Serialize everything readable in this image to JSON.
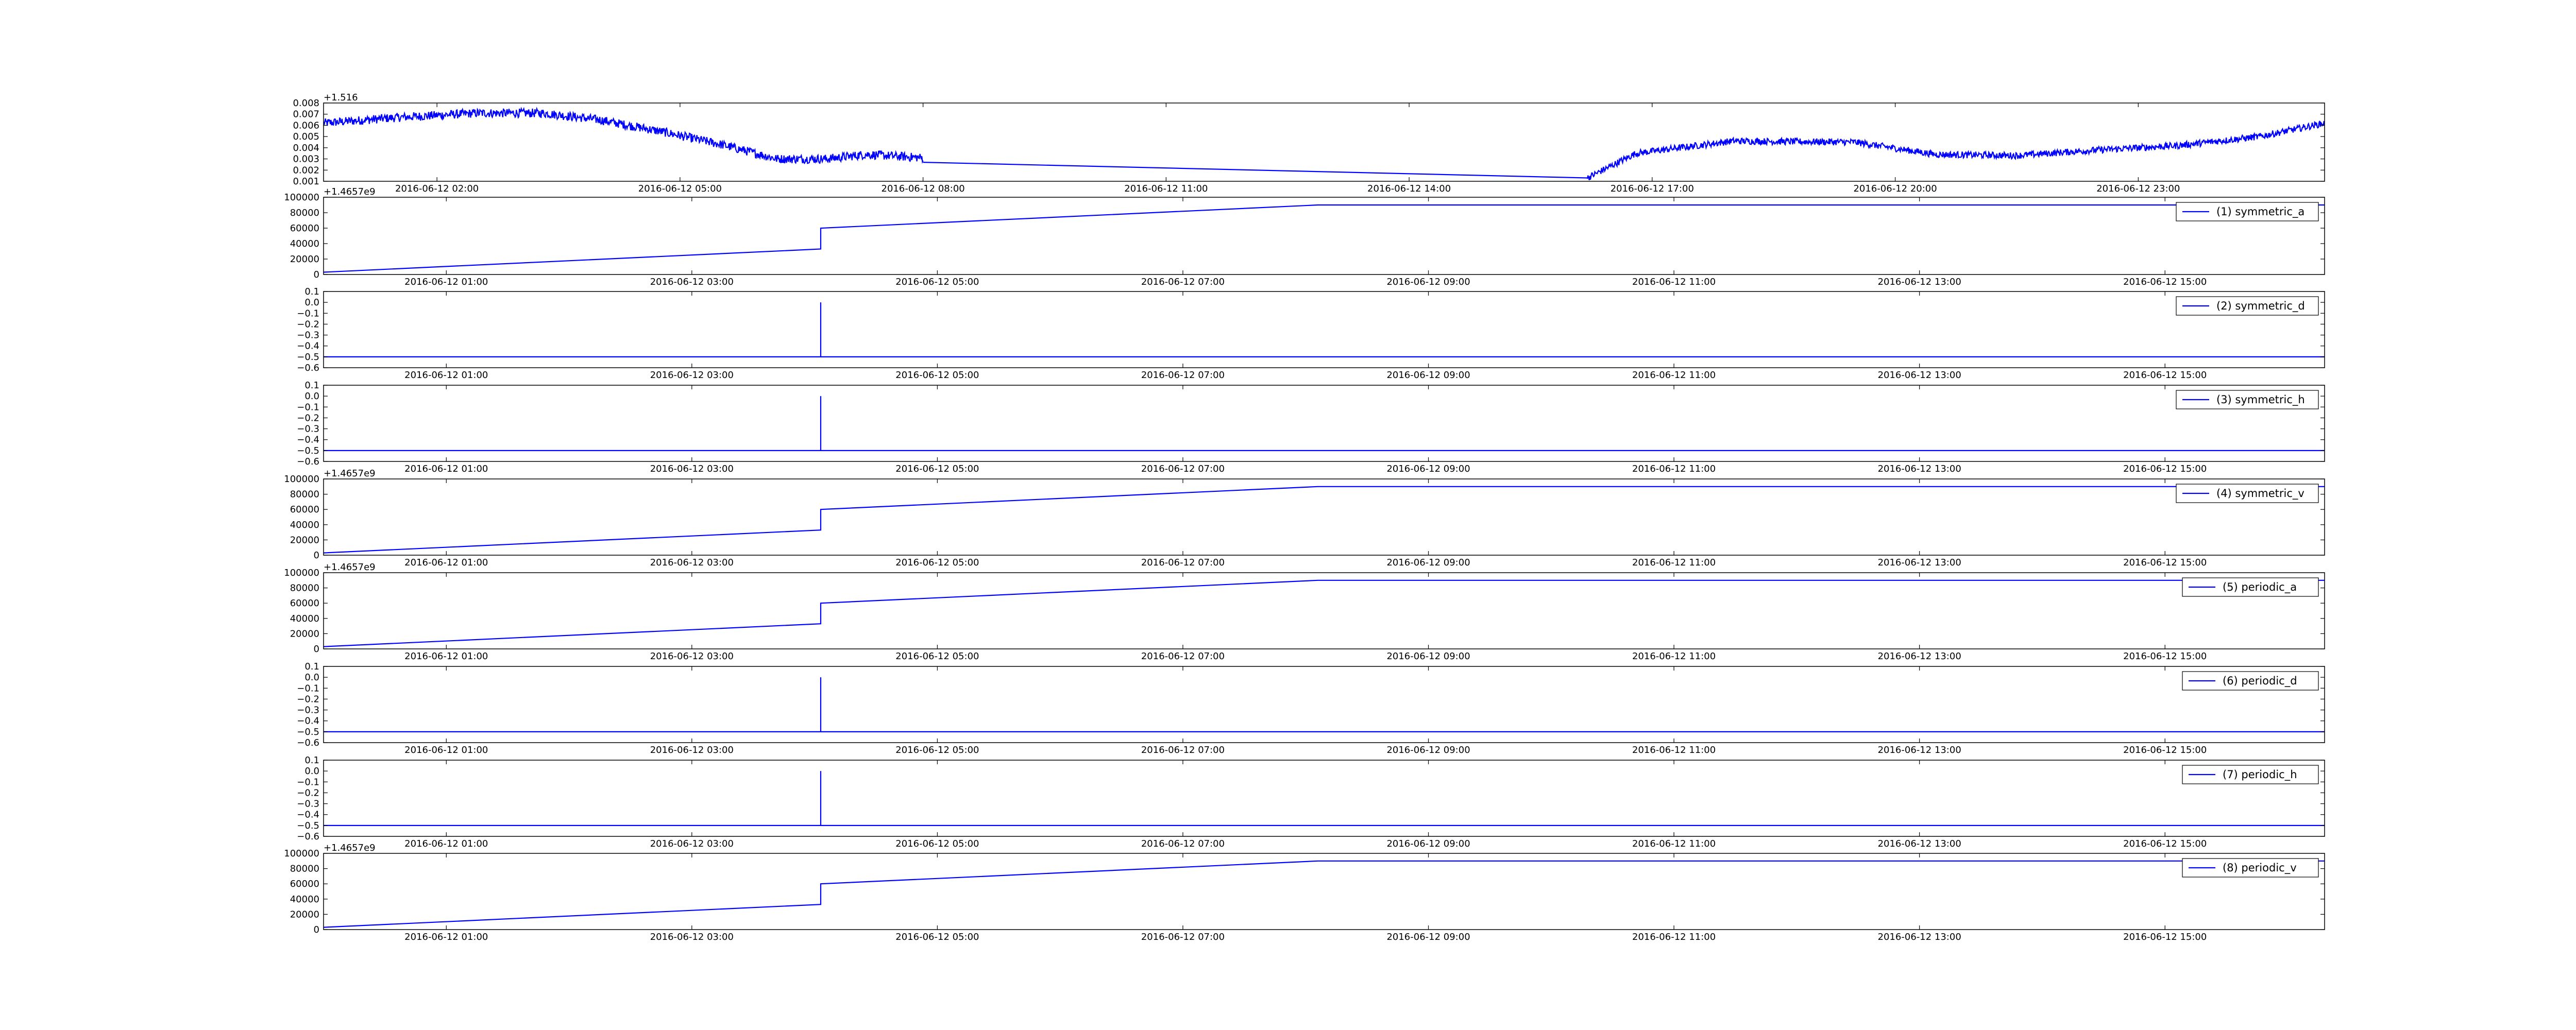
{
  "chart_data": [
    {
      "type": "line",
      "panel": "top-signal",
      "x_ticks": [
        "2016-06-12 02:00",
        "2016-06-12 05:00",
        "2016-06-12 08:00",
        "2016-06-12 11:00",
        "2016-06-12 14:00",
        "2016-06-12 17:00",
        "2016-06-12 20:00",
        "2016-06-12 23:00"
      ],
      "y_ticks": [
        "0.001",
        "0.002",
        "0.003",
        "0.004",
        "0.005",
        "0.006",
        "0.007",
        "0.008"
      ],
      "y_offset_label": "+1.516",
      "ylim": [
        0.001,
        0.008
      ],
      "xlim_hours": [
        0.6,
        25.3
      ],
      "line_color": "#0000ff",
      "series_segments": [
        {
          "x_hours": [
            0.6,
            1.5,
            2.5,
            3.3,
            4.0,
            4.8,
            5.5,
            6.2,
            6.8,
            7.3,
            8.0
          ],
          "values": [
            0.0062,
            0.0067,
            0.0071,
            0.0071,
            0.0065,
            0.0054,
            0.0043,
            0.003,
            0.003,
            0.0034,
            0.0031
          ],
          "noise": 0.0004
        },
        {
          "x_hours": [
            8.0,
            16.2
          ],
          "values": [
            0.0027,
            0.0013
          ],
          "noise": 0
        },
        {
          "x_hours": [
            16.2,
            16.8,
            18.0,
            19.5,
            20.5,
            21.5,
            22.5,
            23.5,
            24.5,
            25.3
          ],
          "values": [
            0.0013,
            0.0035,
            0.0046,
            0.0045,
            0.0034,
            0.0033,
            0.0038,
            0.0042,
            0.005,
            0.0062
          ],
          "noise": 0.0003
        }
      ]
    },
    {
      "type": "line",
      "panel": "signal-1",
      "legend": "(1) symmetric_a",
      "y_ticks": [
        "0",
        "20000",
        "40000",
        "60000",
        "80000",
        "100000"
      ],
      "ylim": [
        0,
        100000
      ],
      "y_offset_label": "+1.4657e9",
      "x_ticks": [
        "2016-06-12 01:00",
        "2016-06-12 03:00",
        "2016-06-12 05:00",
        "2016-06-12 07:00",
        "2016-06-12 09:00",
        "2016-06-12 11:00",
        "2016-06-12 13:00",
        "2016-06-12 15:00"
      ],
      "xlim_hours": [
        0.0,
        16.3
      ],
      "x_hours": [
        0.0,
        4.05,
        4.05,
        8.1,
        16.3
      ],
      "values": [
        3000,
        33000,
        60000,
        90000,
        90000
      ],
      "line_color": "#0000ff"
    },
    {
      "type": "line",
      "panel": "signal-2",
      "legend": "(2) symmetric_d",
      "y_ticks": [
        "−0.6",
        "−0.5",
        "−0.4",
        "−0.3",
        "−0.2",
        "−0.1",
        "0.0",
        "0.1"
      ],
      "ylim": [
        -0.6,
        0.1
      ],
      "x_ticks": [
        "2016-06-12 01:00",
        "2016-06-12 03:00",
        "2016-06-12 05:00",
        "2016-06-12 07:00",
        "2016-06-12 09:00",
        "2016-06-12 11:00",
        "2016-06-12 13:00",
        "2016-06-12 15:00"
      ],
      "xlim_hours": [
        0.0,
        16.3
      ],
      "x_hours": [
        0.0,
        4.05,
        4.05,
        4.05,
        16.3
      ],
      "values": [
        -0.5,
        -0.5,
        0.0,
        -0.5,
        -0.5
      ],
      "line_color": "#0000ff"
    },
    {
      "type": "line",
      "panel": "signal-3",
      "legend": "(3) symmetric_h",
      "y_ticks": [
        "−0.6",
        "−0.5",
        "−0.4",
        "−0.3",
        "−0.2",
        "−0.1",
        "0.0",
        "0.1"
      ],
      "ylim": [
        -0.6,
        0.1
      ],
      "x_ticks": [
        "2016-06-12 01:00",
        "2016-06-12 03:00",
        "2016-06-12 05:00",
        "2016-06-12 07:00",
        "2016-06-12 09:00",
        "2016-06-12 11:00",
        "2016-06-12 13:00",
        "2016-06-12 15:00"
      ],
      "xlim_hours": [
        0.0,
        16.3
      ],
      "x_hours": [
        0.0,
        4.05,
        4.05,
        4.05,
        16.3
      ],
      "values": [
        -0.5,
        -0.5,
        0.0,
        -0.5,
        -0.5
      ],
      "line_color": "#0000ff"
    },
    {
      "type": "line",
      "panel": "signal-4",
      "legend": "(4) symmetric_v",
      "y_ticks": [
        "0",
        "20000",
        "40000",
        "60000",
        "80000",
        "100000"
      ],
      "ylim": [
        0,
        100000
      ],
      "y_offset_label": "+1.4657e9",
      "x_ticks": [
        "2016-06-12 01:00",
        "2016-06-12 03:00",
        "2016-06-12 05:00",
        "2016-06-12 07:00",
        "2016-06-12 09:00",
        "2016-06-12 11:00",
        "2016-06-12 13:00",
        "2016-06-12 15:00"
      ],
      "xlim_hours": [
        0.0,
        16.3
      ],
      "x_hours": [
        0.0,
        4.05,
        4.05,
        8.1,
        16.3
      ],
      "values": [
        3000,
        33000,
        60000,
        90000,
        90000
      ],
      "line_color": "#0000ff"
    },
    {
      "type": "line",
      "panel": "signal-5",
      "legend": "(5) periodic_a",
      "y_ticks": [
        "0",
        "20000",
        "40000",
        "60000",
        "80000",
        "100000"
      ],
      "ylim": [
        0,
        100000
      ],
      "y_offset_label": "+1.4657e9",
      "x_ticks": [
        "2016-06-12 01:00",
        "2016-06-12 03:00",
        "2016-06-12 05:00",
        "2016-06-12 07:00",
        "2016-06-12 09:00",
        "2016-06-12 11:00",
        "2016-06-12 13:00",
        "2016-06-12 15:00"
      ],
      "xlim_hours": [
        0.0,
        16.3
      ],
      "x_hours": [
        0.0,
        4.05,
        4.05,
        8.1,
        16.3
      ],
      "values": [
        3000,
        33000,
        60000,
        90000,
        90000
      ],
      "line_color": "#0000ff"
    },
    {
      "type": "line",
      "panel": "signal-6",
      "legend": "(6) periodic_d",
      "y_ticks": [
        "−0.6",
        "−0.5",
        "−0.4",
        "−0.3",
        "−0.2",
        "−0.1",
        "0.0",
        "0.1"
      ],
      "ylim": [
        -0.6,
        0.1
      ],
      "x_ticks": [
        "2016-06-12 01:00",
        "2016-06-12 03:00",
        "2016-06-12 05:00",
        "2016-06-12 07:00",
        "2016-06-12 09:00",
        "2016-06-12 11:00",
        "2016-06-12 13:00",
        "2016-06-12 15:00"
      ],
      "xlim_hours": [
        0.0,
        16.3
      ],
      "x_hours": [
        0.0,
        4.05,
        4.05,
        4.05,
        16.3
      ],
      "values": [
        -0.5,
        -0.5,
        0.0,
        -0.5,
        -0.5
      ],
      "line_color": "#0000ff"
    },
    {
      "type": "line",
      "panel": "signal-7",
      "legend": "(7) periodic_h",
      "y_ticks": [
        "−0.6",
        "−0.5",
        "−0.4",
        "−0.3",
        "−0.2",
        "−0.1",
        "0.0",
        "0.1"
      ],
      "ylim": [
        -0.6,
        0.1
      ],
      "x_ticks": [
        "2016-06-12 01:00",
        "2016-06-12 03:00",
        "2016-06-12 05:00",
        "2016-06-12 07:00",
        "2016-06-12 09:00",
        "2016-06-12 11:00",
        "2016-06-12 13:00",
        "2016-06-12 15:00"
      ],
      "xlim_hours": [
        0.0,
        16.3
      ],
      "x_hours": [
        0.0,
        4.05,
        4.05,
        4.05,
        16.3
      ],
      "values": [
        -0.5,
        -0.5,
        0.0,
        -0.5,
        -0.5
      ],
      "line_color": "#0000ff"
    },
    {
      "type": "line",
      "panel": "signal-8",
      "legend": "(8) periodic_v",
      "y_ticks": [
        "0",
        "20000",
        "40000",
        "60000",
        "80000",
        "100000"
      ],
      "ylim": [
        0,
        100000
      ],
      "y_offset_label": "+1.4657e9",
      "x_ticks": [
        "2016-06-12 01:00",
        "2016-06-12 03:00",
        "2016-06-12 05:00",
        "2016-06-12 07:00",
        "2016-06-12 09:00",
        "2016-06-12 11:00",
        "2016-06-12 13:00",
        "2016-06-12 15:00"
      ],
      "xlim_hours": [
        0.0,
        16.3
      ],
      "x_hours": [
        0.0,
        4.05,
        4.05,
        8.1,
        16.3
      ],
      "values": [
        3000,
        33000,
        60000,
        90000,
        90000
      ],
      "line_color": "#0000ff"
    }
  ]
}
